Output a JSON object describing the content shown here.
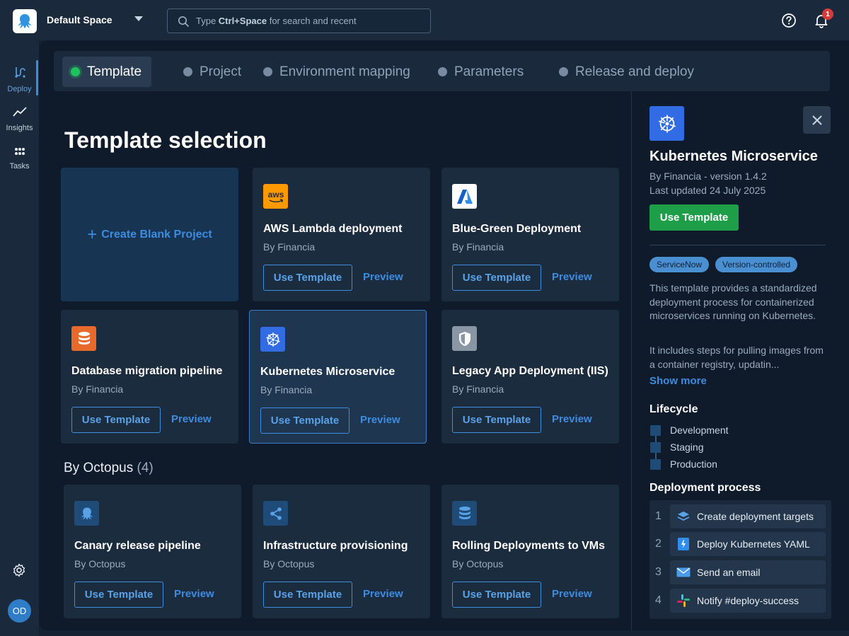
{
  "topbar": {
    "space_name": "Default Space",
    "search_placeholder_pre": "Type ",
    "search_placeholder_key": "Ctrl+Space",
    "search_placeholder_post": " for search and recent",
    "notification_count": "1"
  },
  "leftnav": {
    "items": [
      {
        "label": "Deploy",
        "icon": "deploy-icon",
        "active": true
      },
      {
        "label": "Insights",
        "icon": "insights-icon",
        "active": false
      },
      {
        "label": "Tasks",
        "icon": "tasks-icon",
        "active": false
      }
    ],
    "avatar_initials": "OD"
  },
  "steps": [
    {
      "label": "Template",
      "active": true
    },
    {
      "label": "Project",
      "active": false
    },
    {
      "label": "Environment mapping",
      "active": false
    },
    {
      "label": "Parameters",
      "active": false
    },
    {
      "label": "Release and deploy",
      "active": false
    }
  ],
  "page_title": "Template selection",
  "blank_card": {
    "label": "Create Blank Project"
  },
  "button_labels": {
    "use": "Use Template",
    "preview": "Preview"
  },
  "templates": [
    {
      "title": "AWS Lambda deployment",
      "by": "By Financia",
      "icon": "aws-icon",
      "color": "#f90"
    },
    {
      "title": "Blue-Green Deployment",
      "by": "By Financia",
      "icon": "azure-icon",
      "color": "#ffffff"
    },
    {
      "title": "Database migration pipeline",
      "by": "By Financia",
      "icon": "database-icon",
      "color": "#e8692c"
    },
    {
      "title": "Kubernetes Microservice",
      "by": "By Financia",
      "icon": "kubernetes-icon",
      "color": "#326ce5",
      "selected": true
    },
    {
      "title": "Legacy App Deployment (IIS)",
      "by": "By Financia",
      "icon": "shield-icon",
      "color": "#8a96a3"
    }
  ],
  "octopus_section": {
    "heading": "By Octopus",
    "count": "(4)"
  },
  "octopus_templates": [
    {
      "title": "Canary release pipeline",
      "by": "By Octopus",
      "icon": "octopus-icon"
    },
    {
      "title": "Infrastructure provisioning",
      "by": "By Octopus",
      "icon": "share-icon"
    },
    {
      "title": "Rolling Deployments to VMs",
      "by": "By Octopus",
      "icon": "database-icon"
    }
  ],
  "detail": {
    "title": "Kubernetes Microservice",
    "meta_version": "By Financia - version 1.4.2",
    "meta_updated": "Last updated 24 July 2025",
    "use_label": "Use Template",
    "tags": [
      "ServiceNow",
      "Version-controlled"
    ],
    "desc1": "This template provides a standardized deployment process for containerized microservices running on Kubernetes.",
    "desc2": "It includes steps for pulling images from a container registry, updatin...",
    "show_more": "Show more",
    "lifecycle_heading": "Lifecycle",
    "lifecycle": [
      "Development",
      "Staging",
      "Production"
    ],
    "process_heading": "Deployment process",
    "process": [
      {
        "num": "1",
        "label": "Create deployment targets",
        "icon": "layers-icon"
      },
      {
        "num": "2",
        "label": "Deploy Kubernetes YAML",
        "icon": "yaml-icon"
      },
      {
        "num": "3",
        "label": "Send an email",
        "icon": "email-icon"
      },
      {
        "num": "4",
        "label": "Notify #deploy-success",
        "icon": "slack-icon"
      }
    ]
  }
}
